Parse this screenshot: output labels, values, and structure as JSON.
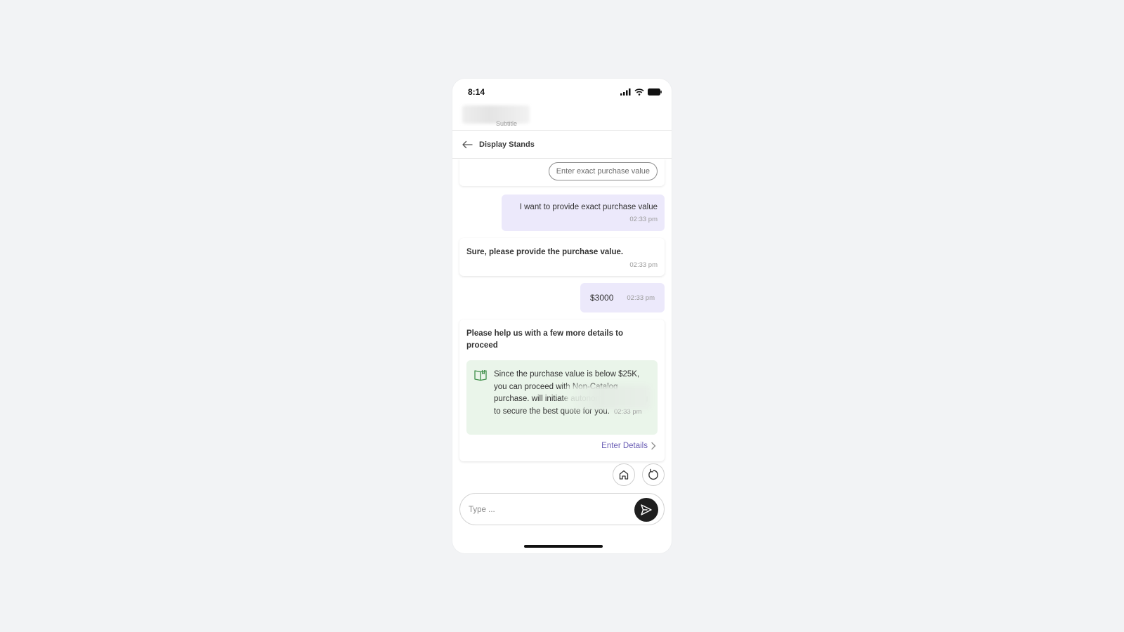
{
  "status_bar": {
    "time": "8:14"
  },
  "header": {
    "subtitle": "Subtitle"
  },
  "nav": {
    "title": "Display Stands"
  },
  "chat": {
    "option_pill": "Enter exact purchase value",
    "messages": [
      {
        "from": "user",
        "text": "I want to provide exact purchase value",
        "time": "02:33 pm"
      },
      {
        "from": "bot",
        "text": "Sure, please provide the purchase value.",
        "time": "02:33 pm"
      },
      {
        "from": "user",
        "text": "$3000",
        "time": "02:33 pm"
      }
    ],
    "details_card": {
      "heading": "Please help us with a few more details to proceed",
      "info_text": "Since the purchase value is below $25K, you can proceed with Non-Catalog purchase. will initiate autonomous sourcing to secure the best quote for you.",
      "time": "02:33 pm",
      "action_label": "Enter Details"
    }
  },
  "composer": {
    "placeholder": "Type ..."
  },
  "icons": {
    "back": "arrow-left-icon",
    "info": "book-icon",
    "home": "home-icon",
    "restart": "refresh-icon",
    "send": "send-icon",
    "chevron": "chevron-right-icon"
  },
  "colors": {
    "user_bubble": "#ece9fb",
    "info_box": "#eaf5ea",
    "link": "#6b5fb5",
    "send_button": "#1f1f1f"
  }
}
